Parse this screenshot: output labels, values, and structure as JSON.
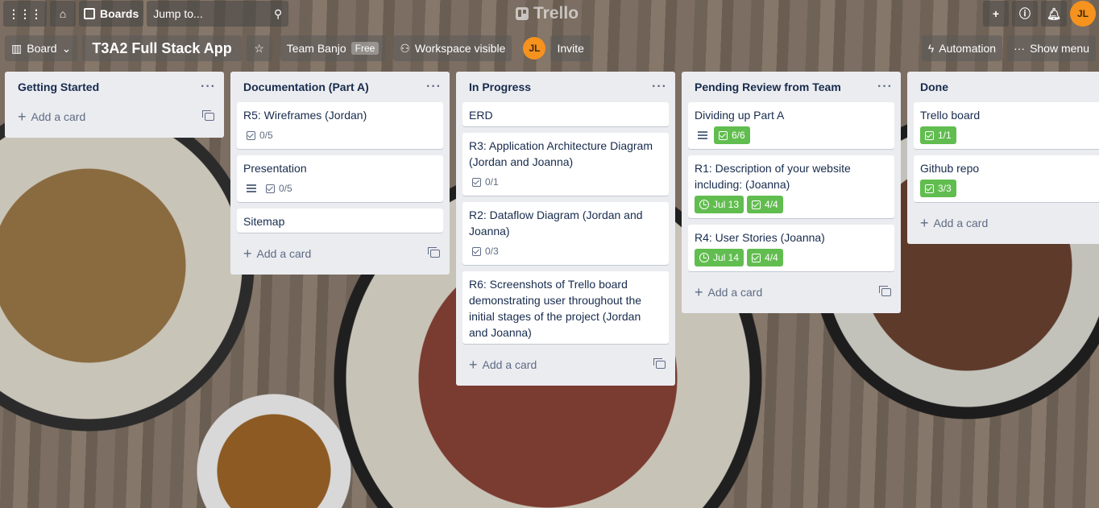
{
  "topbar": {
    "boards_label": "Boards",
    "search_placeholder": "Jump to...",
    "logo_text": "Trello",
    "avatar_initials": "JL"
  },
  "boardbar": {
    "view_label": "Board",
    "board_title": "T3A2 Full Stack App",
    "team_label": "Team Banjo",
    "team_badge": "Free",
    "visibility_label": "Workspace visible",
    "member_initials": "JL",
    "invite_label": "Invite",
    "automation_label": "Automation",
    "menu_label": "Show menu"
  },
  "add_card_label": "Add a card",
  "lists": [
    {
      "title": "Getting Started",
      "cards": []
    },
    {
      "title": "Documentation (Part A)",
      "cards": [
        {
          "title": "R5: Wireframes (Jordan)",
          "checklist": "0/5"
        },
        {
          "title": "Presentation",
          "checklist": "0/5"
        },
        {
          "title": "Sitemap"
        }
      ]
    },
    {
      "title": "In Progress",
      "cards": [
        {
          "title": "ERD"
        },
        {
          "title": "R3: Application Architecture Diagram (Jordan and Joanna)",
          "checklist": "0/1"
        },
        {
          "title": "R2: Dataflow Diagram (Jordan and Joanna)",
          "checklist": "0/3"
        },
        {
          "title": "R6: Screenshots of Trello board demonstrating user throughout the initial stages of the project (Jordan and Joanna)"
        }
      ]
    },
    {
      "title": "Pending Review from Team",
      "cards": [
        {
          "title": "Dividing up Part A",
          "checklist": "6/6"
        },
        {
          "title": "R1: Description of your website including: (Joanna)",
          "due": "Jul 13",
          "checklist": "4/4"
        },
        {
          "title": "R4: User Stories (Joanna)",
          "due": "Jul 14",
          "checklist": "4/4"
        }
      ]
    },
    {
      "title": "Done",
      "cards": [
        {
          "title": "Trello board",
          "checklist": "1/1"
        },
        {
          "title": "Github repo",
          "checklist": "3/3"
        }
      ]
    }
  ],
  "colors": {
    "list_bg": "#ebecf0",
    "complete_green": "#61bd4f",
    "avatar_orange": "#f6921e"
  }
}
